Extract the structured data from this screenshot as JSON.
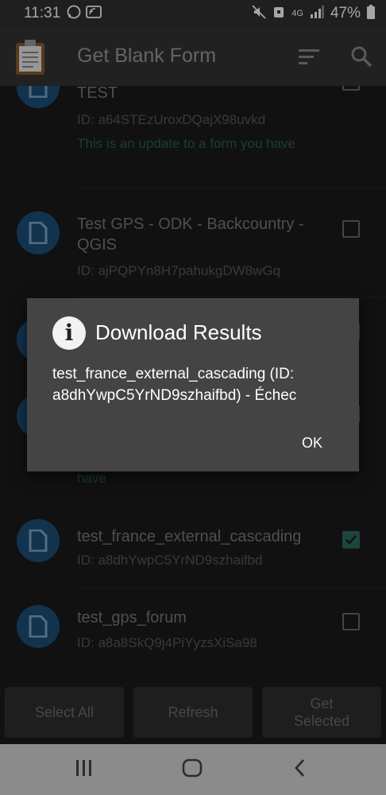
{
  "status_bar": {
    "time": "11:31",
    "network": "4G",
    "battery": "47%"
  },
  "app_bar": {
    "title": "Get Blank Form"
  },
  "forms": [
    {
      "name": "TEST",
      "id": "ID: a64STEzUroxDQajX98uvkd",
      "update_note": "This is an update to a form you have",
      "checked": false
    },
    {
      "name": "Test GPS - ODK - Backcountry - QGIS",
      "id": "ID: ajPQPYn8H7pahukgDW8wGq",
      "checked": false
    },
    {
      "update_note": "have",
      "checked": false
    },
    {
      "name": "test_france_external_cascading",
      "id": "ID: a8dhYwpC5YrND9szhaifbd",
      "checked": true
    },
    {
      "name": "test_gps_forum",
      "id": "ID: a8a8SkQ9j4PiYyzsXiSa98",
      "checked": false
    }
  ],
  "buttons": {
    "select_all": "Select All",
    "refresh": "Refresh",
    "get_selected_line1": "Get",
    "get_selected_line2": "Selected"
  },
  "dialog": {
    "title": "Download Results",
    "message": "test_france_external_cascading (ID: a8dhYwpC5YrND9szhaifbd) - Échec",
    "ok_label": "OK"
  },
  "colors": {
    "accent": "#2c6b60",
    "avatar": "#1d4f78"
  }
}
